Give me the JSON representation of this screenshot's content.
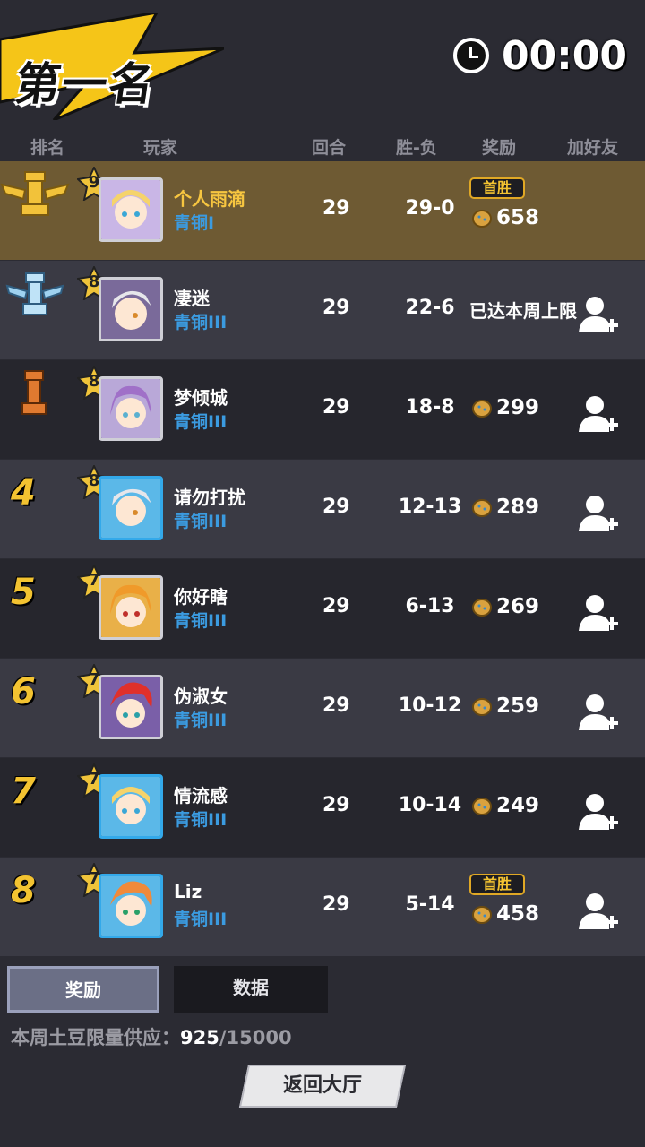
{
  "header": {
    "title": "第一名",
    "timer": "00:00"
  },
  "columns": {
    "rank": "排名",
    "player": "玩家",
    "rounds": "回合",
    "win_loss": "胜-负",
    "reward": "奖励",
    "add_friend": "加好友"
  },
  "rows": [
    {
      "rank": "1",
      "level": "9",
      "name": "个人雨滴",
      "tier": "青铜I",
      "rounds": "29",
      "wl": "29-0",
      "reward": "658",
      "first_win": "首胜"
    },
    {
      "rank": "2",
      "level": "8",
      "name": "凄迷",
      "tier": "青铜III",
      "rounds": "29",
      "wl": "22-6",
      "reward_note": "已达本周上限"
    },
    {
      "rank": "3",
      "level": "8",
      "name": "梦倾城",
      "tier": "青铜III",
      "rounds": "29",
      "wl": "18-8",
      "reward": "299"
    },
    {
      "rank": "4",
      "level": "8",
      "name": "请勿打扰",
      "tier": "青铜III",
      "rounds": "29",
      "wl": "12-13",
      "reward": "289"
    },
    {
      "rank": "5",
      "level": "7",
      "name": "你好瞎",
      "tier": "青铜III",
      "rounds": "29",
      "wl": "6-13",
      "reward": "269"
    },
    {
      "rank": "6",
      "level": "7",
      "name": "伪淑女",
      "tier": "青铜III",
      "rounds": "29",
      "wl": "10-12",
      "reward": "259"
    },
    {
      "rank": "7",
      "level": "7",
      "name": "情流感",
      "tier": "青铜III",
      "rounds": "29",
      "wl": "10-14",
      "reward": "249"
    },
    {
      "rank": "8",
      "level": "7",
      "name": "Liz",
      "tier": "青铜III",
      "rounds": "29",
      "wl": "5-14",
      "reward": "458",
      "first_win": "首胜"
    }
  ],
  "tabs": {
    "reward": "奖励",
    "stats": "数据"
  },
  "supply": {
    "label": "本周土豆限量供应：",
    "current": "925",
    "total": "/15000"
  },
  "back_button": "返回大厅",
  "colors": {
    "gold_text": "#f7c640",
    "tier_blue": "#3b9be0",
    "first_row_bg": "#6e5a33"
  }
}
